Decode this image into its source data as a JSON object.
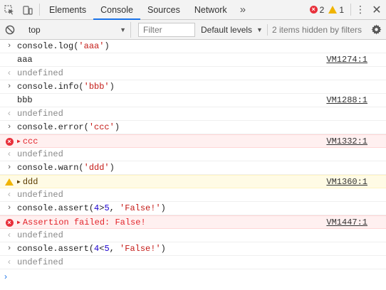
{
  "toolbar": {
    "tabs": [
      {
        "label": "Elements",
        "active": false
      },
      {
        "label": "Console",
        "active": true
      },
      {
        "label": "Sources",
        "active": false
      },
      {
        "label": "Network",
        "active": false
      }
    ],
    "more_tabs": "»",
    "error_count": "2",
    "warning_count": "1",
    "kebab": "⋮",
    "close": "✕"
  },
  "console_toolbar": {
    "context": "top",
    "filter_placeholder": "Filter",
    "levels": "Default levels",
    "hidden_items": "2 items hidden by filters"
  },
  "log": [
    {
      "kind": "input",
      "code": "console.log('aaa')"
    },
    {
      "kind": "log",
      "text": "aaa",
      "source": "VM1274:1"
    },
    {
      "kind": "result",
      "text": "undefined"
    },
    {
      "kind": "input",
      "code": "console.info('bbb')"
    },
    {
      "kind": "log",
      "text": "bbb",
      "source": "VM1288:1"
    },
    {
      "kind": "result",
      "text": "undefined"
    },
    {
      "kind": "input",
      "code": "console.error('ccc')"
    },
    {
      "kind": "error",
      "text": "ccc",
      "source": "VM1332:1"
    },
    {
      "kind": "result",
      "text": "undefined"
    },
    {
      "kind": "input",
      "code": "console.warn('ddd')"
    },
    {
      "kind": "warn",
      "text": "ddd",
      "source": "VM1360:1"
    },
    {
      "kind": "result",
      "text": "undefined"
    },
    {
      "kind": "input",
      "code": "console.assert(4>5, 'False!')"
    },
    {
      "kind": "error",
      "text": "Assertion failed: False!",
      "source": "VM1447:1"
    },
    {
      "kind": "result",
      "text": "undefined"
    },
    {
      "kind": "input",
      "code": "console.assert(4<5, 'False!')"
    },
    {
      "kind": "result",
      "text": "undefined"
    }
  ],
  "prompt": "›",
  "colors": {
    "accent": "#1a73e8",
    "error": "#e3242b",
    "error_bg": "#fff0f0",
    "warn_bg": "#fffbe5",
    "warn_icon": "#f0b400"
  }
}
